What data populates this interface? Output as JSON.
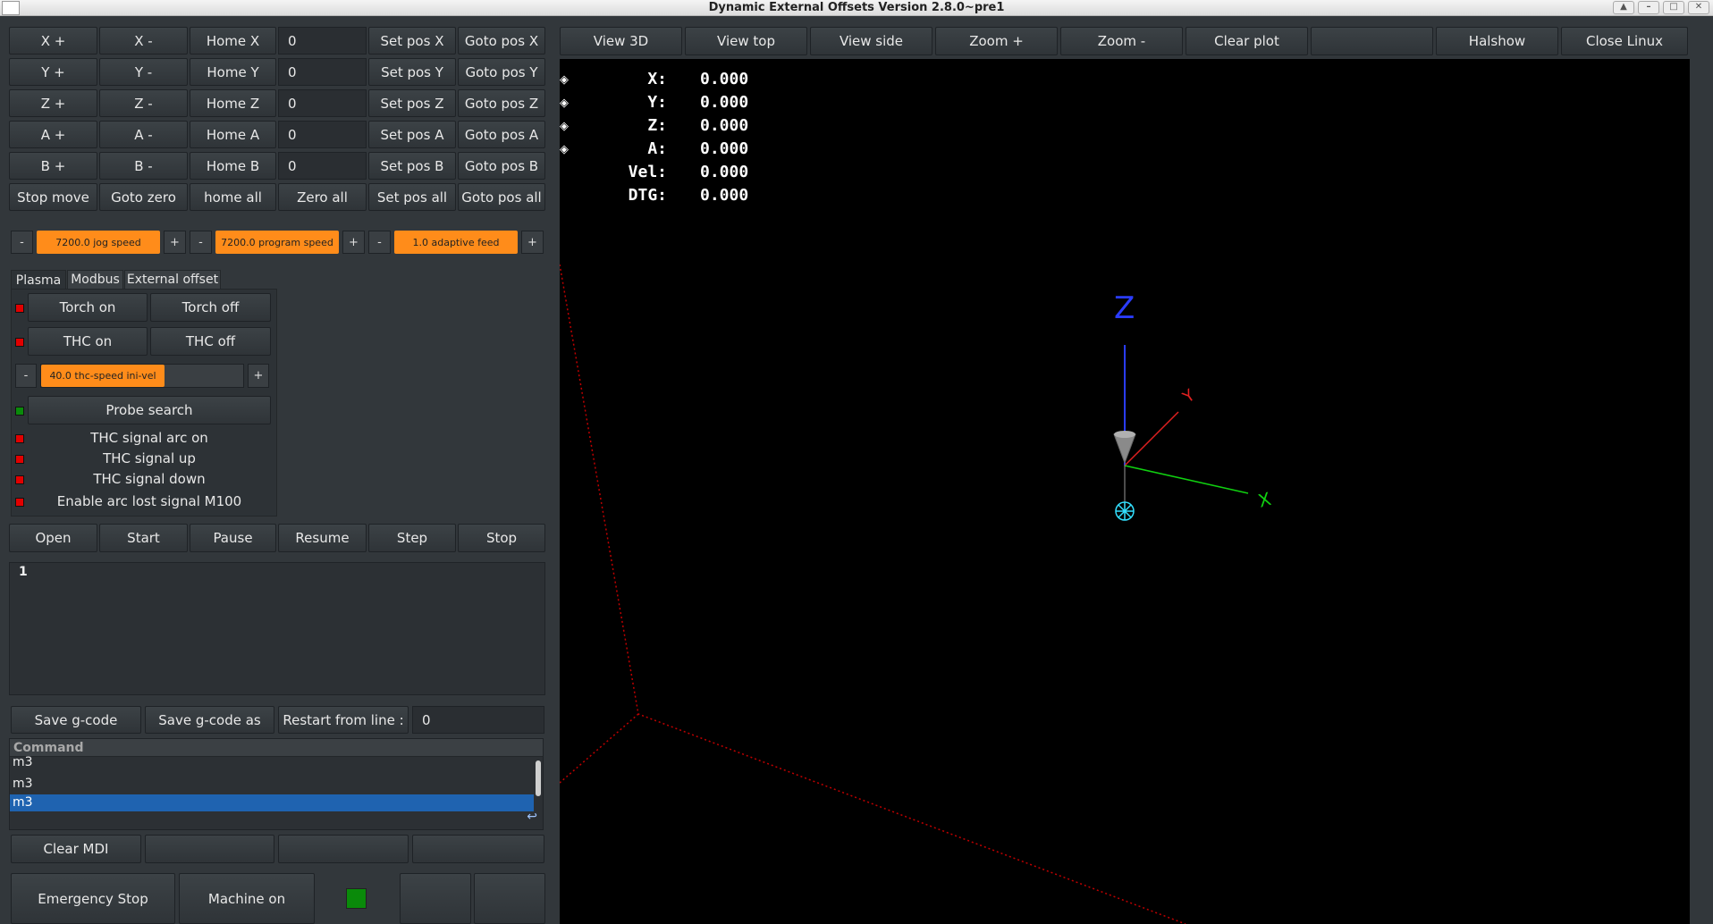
{
  "window": {
    "title": "Dynamic External Offsets Version 2.8.0~pre1"
  },
  "axes": [
    {
      "plus": "X +",
      "minus": "X -",
      "home": "Home X",
      "value": "0",
      "setpos": "Set pos X",
      "goto": "Goto pos X"
    },
    {
      "plus": "Y +",
      "minus": "Y -",
      "home": "Home Y",
      "value": "0",
      "setpos": "Set pos Y",
      "goto": "Goto pos Y"
    },
    {
      "plus": "Z +",
      "minus": "Z -",
      "home": "Home Z",
      "value": "0",
      "setpos": "Set pos Z",
      "goto": "Goto pos Z"
    },
    {
      "plus": "A +",
      "minus": "A -",
      "home": "Home A",
      "value": "0",
      "setpos": "Set pos A",
      "goto": "Goto pos A"
    },
    {
      "plus": "B +",
      "minus": "B -",
      "home": "Home B",
      "value": "0",
      "setpos": "Set pos B",
      "goto": "Goto pos B"
    }
  ],
  "all_row": {
    "stop_move": "Stop move",
    "goto_zero": "Goto zero",
    "home_all": "home all",
    "zero_all": "Zero all",
    "set_pos_all": "Set pos all",
    "goto_pos_all": "Goto pos all"
  },
  "speed": {
    "minus": "-",
    "plus": "+",
    "jog": "7200.0 jog speed",
    "program": "7200.0 program speed",
    "adaptive": "1.0 adaptive feed"
  },
  "tabs": [
    "Plasma",
    "Modbus",
    "External offset"
  ],
  "plasma": {
    "torch_on": "Torch on",
    "torch_off": "Torch off",
    "thc_on": "THC on",
    "thc_off": "THC off",
    "thc_speed": "40.0 thc-speed ini-vel",
    "thc_speed_fraction": 0.61,
    "probe_search": "Probe search",
    "signal_arc_on": "THC signal arc on",
    "signal_up": "THC signal up",
    "signal_down": "THC signal down",
    "arc_lost": "Enable arc lost signal M100"
  },
  "program": {
    "open": "Open",
    "start": "Start",
    "pause": "Pause",
    "resume": "Resume",
    "step": "Step",
    "stop": "Stop"
  },
  "gcode": {
    "line_number": "1"
  },
  "file_row": {
    "save": "Save g-code",
    "save_as": "Save g-code as",
    "restart_label": "Restart from line :",
    "restart_value": "0"
  },
  "mdi": {
    "header": "Command",
    "rows": [
      "m3",
      "m3",
      "m3"
    ],
    "clear": "Clear MDI",
    "enter_icon": "↩"
  },
  "machine": {
    "estop": "Emergency Stop",
    "machine_on": "Machine on"
  },
  "view_toolbar": {
    "view3d": "View 3D",
    "viewtop": "View top",
    "viewside": "View side",
    "zoom_in": "Zoom +",
    "zoom_out": "Zoom -",
    "clear_plot": "Clear plot",
    "halshow": "Halshow",
    "close_linux": "Close Linux"
  },
  "dro": [
    {
      "label": "X:",
      "value": "0.000"
    },
    {
      "label": "Y:",
      "value": "0.000"
    },
    {
      "label": "Z:",
      "value": "0.000"
    },
    {
      "label": "A:",
      "value": "0.000"
    },
    {
      "label": "Vel:",
      "value": "0.000"
    },
    {
      "label": "DTG:",
      "value": "0.000"
    }
  ],
  "colors": {
    "accent": "#ff8c1a",
    "led_off": "#e10000",
    "led_on": "#0a8a0a",
    "selection": "#1f63b0"
  }
}
